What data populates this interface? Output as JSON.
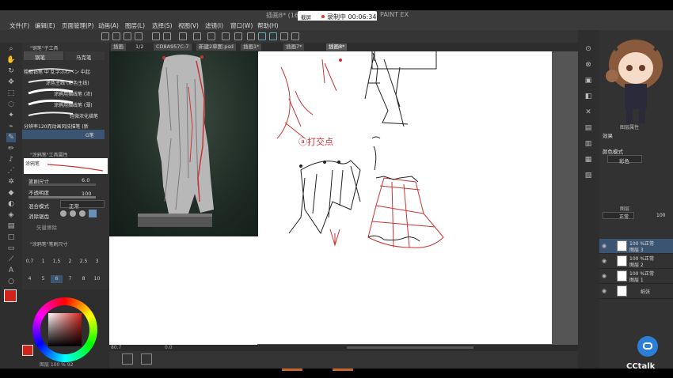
{
  "window": {
    "title": "插画8* (165",
    "suffix": "PAINT EX"
  },
  "recording": {
    "text": "录制中 00:06:34",
    "tag": "截屏"
  },
  "menu": [
    "文件(F)",
    "编辑(E)",
    "页面管理(P)",
    "动画(A)",
    "图层(L)",
    "选择(S)",
    "视图(V)",
    "滤镜(I)",
    "窗口(W)",
    "帮助(H)"
  ],
  "tabs": [
    "插画",
    "1/2",
    "CD8A957C-7",
    "新建2草图.psd",
    "插画1*",
    "插画7*",
    "插画8*"
  ],
  "subtool": {
    "header": "\"钢笔\"子工具",
    "tab_pen": "钢笔",
    "tab_marker": "马克笔",
    "brushes": [
      "粗糙铅笔 中 乱字ふわペン 中起",
      "涂色主线 (彩色主线)",
      "涂鸦用描线笔 (浓)",
      "涂鸦用描线笔 (薄)",
      "轻微浓化描笔",
      "分辨率120而动画风技描笔 (新",
      "G笔"
    ]
  },
  "tool_property": {
    "header": "\"涂鸦笔\"工具属性",
    "name": "涂鸦笔",
    "size_label": "笔刷尺寸",
    "size_value": "6.0",
    "opacity_label": "不透明度",
    "opacity_value": "100",
    "blend_label": "混合模式",
    "blend_value": "正常",
    "aa_label": "消除锯齿",
    "extra_label": "矢量擦除"
  },
  "brush_size": {
    "header": "\"涂鸦笔\"笔刷尺寸",
    "values": [
      "0.7",
      "1",
      "1.5",
      "2",
      "2.5",
      "3",
      "4",
      "5",
      "6",
      "7",
      "8",
      "10"
    ]
  },
  "right_panel": {
    "layer_props": "图层属性",
    "effect": "效果",
    "color_mode_label": "颜色模式",
    "color_mode_value": "彩色",
    "layer_header": "图层",
    "blend": "正常",
    "opacity": "100",
    "layers": [
      {
        "percent": "100 %正常",
        "name": "图层 3"
      },
      {
        "percent": "100 %正常",
        "name": "图层 2"
      },
      {
        "percent": "100 %正常",
        "name": "图层 1"
      },
      {
        "percent": "",
        "name": "纸张"
      }
    ]
  },
  "status": {
    "zoom": "80.7",
    "angle": "0.0",
    "color_info": "图层 100 % 92"
  },
  "annotation_text": "ⓐ打交点",
  "logo": "CCtalk",
  "colors": {
    "main": "#d2231a",
    "sub": "#ffffff",
    "accent": "#3b5472"
  }
}
